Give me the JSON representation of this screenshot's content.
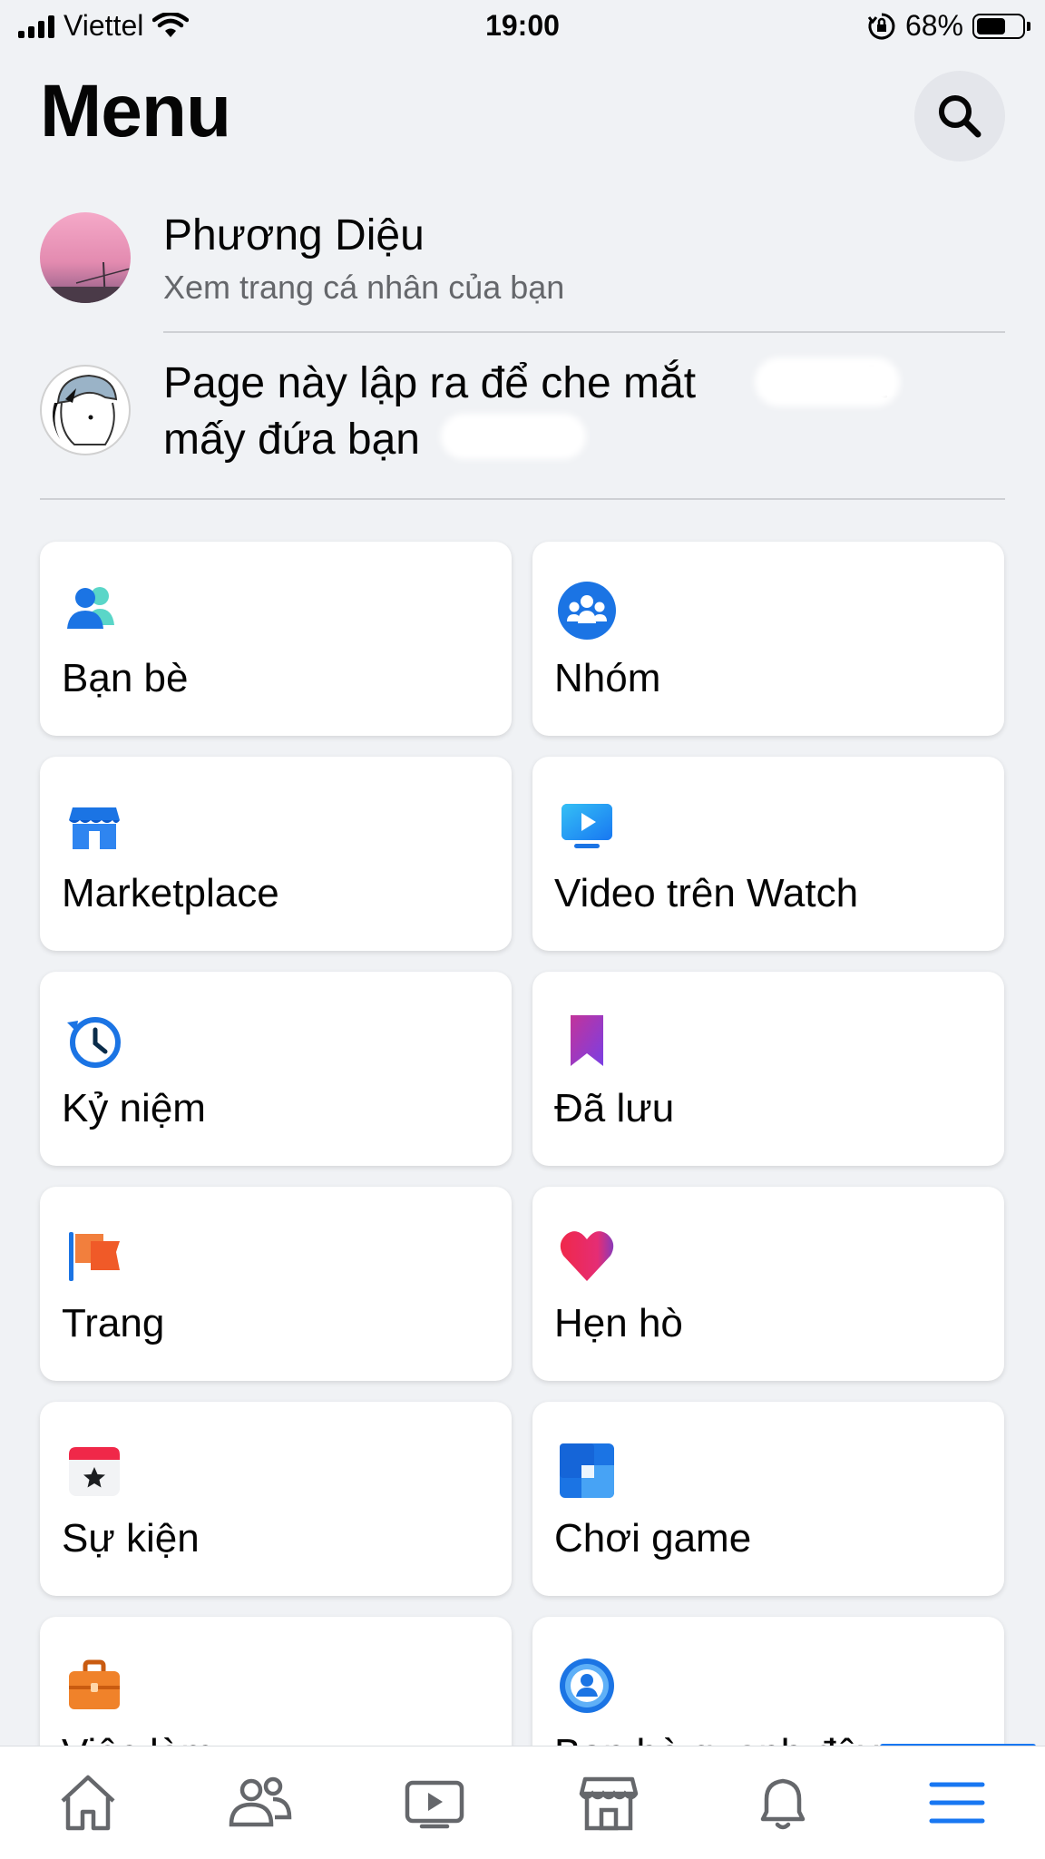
{
  "status_bar": {
    "carrier": "Viettel",
    "time": "19:00",
    "battery_percent": "68%",
    "battery_level": 0.68
  },
  "header": {
    "title": "Menu",
    "search_icon": "search-icon"
  },
  "profile": {
    "name": "Phương Diệu",
    "subtitle": "Xem trang cá nhân của bạn"
  },
  "page": {
    "name_line1": "Page này lập ra để che mắt",
    "name_line1_tail": "và",
    "name_line2": "mấy đứa bạn"
  },
  "shortcuts": [
    {
      "label": "Bạn bè",
      "icon": "friends-icon"
    },
    {
      "label": "Nhóm",
      "icon": "groups-icon"
    },
    {
      "label": "Marketplace",
      "icon": "marketplace-icon"
    },
    {
      "label": "Video trên Watch",
      "icon": "watch-icon"
    },
    {
      "label": "Kỷ niệm",
      "icon": "memories-icon"
    },
    {
      "label": "Đã lưu",
      "icon": "saved-icon"
    },
    {
      "label": "Trang",
      "icon": "pages-flag-icon"
    },
    {
      "label": "Hẹn hò",
      "icon": "dating-heart-icon"
    },
    {
      "label": "Sự kiện",
      "icon": "events-calendar-icon"
    },
    {
      "label": "Chơi game",
      "icon": "gaming-icon"
    },
    {
      "label": "Việc làm",
      "icon": "jobs-briefcase-icon"
    },
    {
      "label": "Bạn bè quanh đây",
      "icon": "nearby-friends-icon"
    }
  ],
  "tabbar": {
    "tabs": [
      "home-icon",
      "friends-tab-icon",
      "watch-tab-icon",
      "marketplace-tab-icon",
      "notifications-bell-icon",
      "menu-hamburger-icon"
    ],
    "active": "menu-hamburger-icon"
  },
  "colors": {
    "accent": "#1877f2",
    "background": "#f0f2f5",
    "secondary_text": "#65676b"
  }
}
